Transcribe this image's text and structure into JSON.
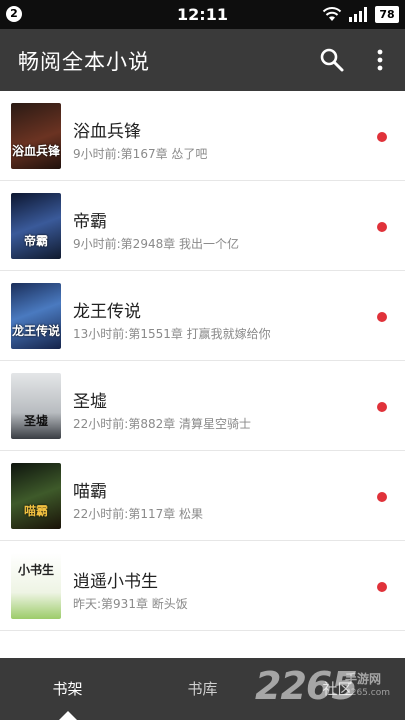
{
  "status_bar": {
    "notification_count": "2",
    "time": "12:11",
    "battery": "78"
  },
  "app_bar": {
    "title": "畅阅全本小说",
    "search_icon": "search-icon",
    "more_icon": "more-vert-icon"
  },
  "books": [
    {
      "title": "浴血兵锋",
      "subtitle": "9小时前:第167章 怂了吧",
      "cover_text": "浴血兵锋",
      "cover_color": "#5a2a1e",
      "unread": true
    },
    {
      "title": "帝霸",
      "subtitle": "9小时前:第2948章 我出一个亿",
      "cover_text": "帝霸",
      "cover_color": "#1c2c50",
      "unread": true
    },
    {
      "title": "龙王传说",
      "subtitle": "13小时前:第1551章 打赢我就嫁给你",
      "cover_text": "龙王传说",
      "cover_color": "#2a4a80",
      "unread": true
    },
    {
      "title": "圣墟",
      "subtitle": "22小时前:第882章 清算星空骑士",
      "cover_text": "圣墟",
      "cover_color": "#c8ccd0",
      "unread": true
    },
    {
      "title": "喵霸",
      "subtitle": "22小时前:第117章 松果",
      "cover_text": "喵霸",
      "cover_color": "#1e2a1a",
      "unread": true
    },
    {
      "title": "逍遥小书生",
      "subtitle": "昨天:第931章 断头饭",
      "cover_text": "小书生",
      "cover_color": "#e8f0d8",
      "unread": true
    }
  ],
  "bottom_nav": {
    "tabs": [
      {
        "label": "书架",
        "active": true
      },
      {
        "label": "书库",
        "active": false
      },
      {
        "label": "社区",
        "active": false
      }
    ]
  },
  "watermark": {
    "logo": "2265",
    "sub": "手游网",
    "url": "2265.com"
  },
  "colors": {
    "app_bar": "#3a3a3a",
    "status_bar": "#0e0e0e",
    "unread_dot": "#e0323a"
  }
}
